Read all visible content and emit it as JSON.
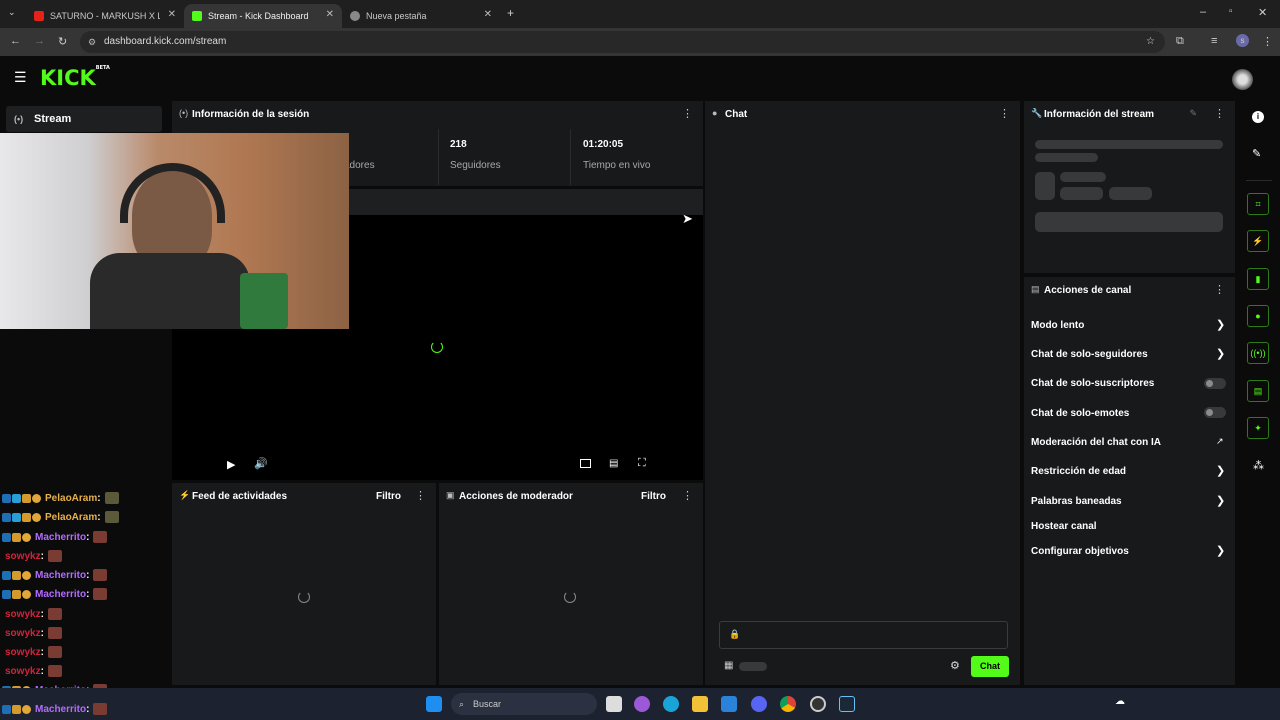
{
  "browser": {
    "tabs": [
      {
        "label": "SATURNO - MARKUSH X LIL RO",
        "active": false
      },
      {
        "label": "Stream - Kick Dashboard",
        "active": true
      },
      {
        "label": "Nueva pestaña",
        "active": false
      }
    ],
    "url": "dashboard.kick.com/stream"
  },
  "header": {
    "logo": "KICK",
    "logo_sup": "BETA"
  },
  "sidebar": {
    "stream_label": "Stream"
  },
  "session": {
    "title": "Información de la sesión",
    "stats": [
      {
        "value": "",
        "label": "adores"
      },
      {
        "value": "218",
        "label": "Seguidores"
      },
      {
        "value": "01:20:05",
        "label": "Tiempo en vivo"
      }
    ]
  },
  "chat": {
    "title": "Chat",
    "send_label": "Chat",
    "input_placeholder": ""
  },
  "stream_info": {
    "title": "Información del stream"
  },
  "channel_actions": {
    "title": "Acciones de canal",
    "items": [
      {
        "label": "Modo lento",
        "control": "chevron"
      },
      {
        "label": "Chat de solo-seguidores",
        "control": "chevron"
      },
      {
        "label": "Chat de solo-suscriptores",
        "control": "toggle"
      },
      {
        "label": "Chat de solo-emotes",
        "control": "toggle"
      },
      {
        "label": "Moderación del chat con IA",
        "control": "external"
      },
      {
        "label": "Restricción de edad",
        "control": "chevron"
      },
      {
        "label": "Palabras baneadas",
        "control": "chevron"
      },
      {
        "label": "Hostear canal",
        "control": "none"
      },
      {
        "label": "Configurar objetivos",
        "control": "chevron"
      }
    ]
  },
  "activity_feed": {
    "title": "Feed de actividades",
    "filter": "Filtro"
  },
  "mod_actions": {
    "title": "Acciones de moderador",
    "filter": "Filtro"
  },
  "overlay_chat": [
    {
      "user": "PelaoAram",
      "color": "#e6b04a"
    },
    {
      "user": "PelaoAram",
      "color": "#e6b04a"
    },
    {
      "user": "Macherrito",
      "color": "#b36bff"
    },
    {
      "user": "sowykz",
      "color": "#d0233b"
    },
    {
      "user": "Macherrito",
      "color": "#b36bff"
    },
    {
      "user": "Macherrito",
      "color": "#b36bff"
    },
    {
      "user": "sowykz",
      "color": "#d0233b"
    },
    {
      "user": "sowykz",
      "color": "#d0233b"
    },
    {
      "user": "sowykz",
      "color": "#d0233b"
    },
    {
      "user": "sowykz",
      "color": "#d0233b"
    },
    {
      "user": "Macherrito",
      "color": "#b36bff"
    },
    {
      "user": "Macherrito",
      "color": "#b36bff"
    }
  ],
  "taskbar": {
    "search_label": "Buscar"
  },
  "colors": {
    "accent": "#53fc18",
    "panel": "#18191b",
    "background": "#0b0b0c"
  }
}
